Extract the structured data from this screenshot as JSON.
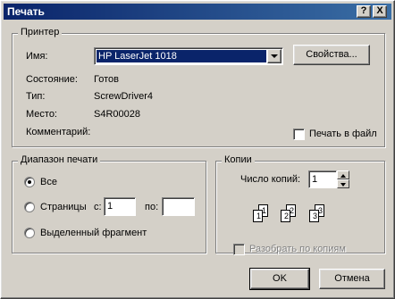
{
  "dialog": {
    "title": "Печать",
    "help_button": "?",
    "close_button": "X"
  },
  "printer": {
    "group_label": "Принтер",
    "name_label": "Имя:",
    "name_value": "HP LaserJet 1018",
    "properties_button": "Свойства...",
    "status_label": "Состояние:",
    "status_value": "Готов",
    "type_label": "Тип:",
    "type_value": "ScrewDriver4",
    "location_label": "Место:",
    "location_value": "S4R00028",
    "comment_label": "Комментарий:",
    "print_to_file_label": "Печать в файл",
    "print_to_file_checked": false
  },
  "range": {
    "group_label": "Диапазон печати",
    "all_label": "Все",
    "pages_label": "Страницы",
    "from_label": "с:",
    "from_value": "1",
    "to_label": "по:",
    "to_value": "",
    "selection_label": "Выделенный фрагмент",
    "selected": "all"
  },
  "copies": {
    "group_label": "Копии",
    "count_label": "Число копий:",
    "count_value": "1",
    "collate_label": "Разобрать по копиям",
    "collate_checked": false,
    "collate_enabled": false,
    "page_numbers": [
      "1",
      "1",
      "2",
      "2",
      "3",
      "3"
    ]
  },
  "buttons": {
    "ok": "OK",
    "cancel": "Отмена"
  }
}
